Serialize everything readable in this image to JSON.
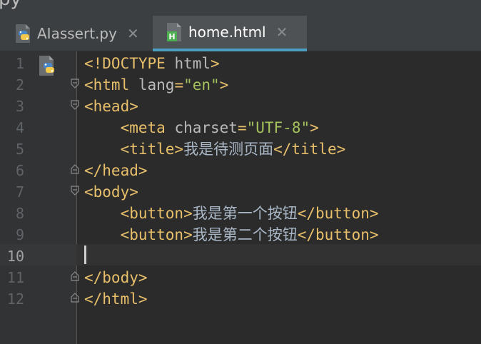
{
  "window": {
    "title_fragment": "py"
  },
  "tabs": [
    {
      "label": "AIassert.py",
      "icon": "python-file-icon",
      "active": false,
      "close": "✕"
    },
    {
      "label": "home.html",
      "icon": "html-file-icon",
      "active": true,
      "close": "✕"
    }
  ],
  "editor": {
    "current_line": 10,
    "lines": [
      {
        "n": "1",
        "pre": "",
        "tokens": [
          [
            "tag",
            "<!DOCTYPE "
          ],
          [
            "attr",
            "html"
          ],
          [
            "tag",
            ">"
          ]
        ]
      },
      {
        "n": "2",
        "pre": "",
        "tokens": [
          [
            "tag",
            "<html "
          ],
          [
            "attr",
            "lang"
          ],
          [
            "tag",
            "="
          ],
          [
            "str",
            "\"en\""
          ],
          [
            "tag",
            ">"
          ]
        ]
      },
      {
        "n": "3",
        "pre": "",
        "tokens": [
          [
            "tag",
            "<head>"
          ]
        ]
      },
      {
        "n": "4",
        "pre": "    ",
        "tokens": [
          [
            "tag",
            "<meta "
          ],
          [
            "attr",
            "charset"
          ],
          [
            "tag",
            "="
          ],
          [
            "str",
            "\"UTF-8\""
          ],
          [
            "tag",
            ">"
          ]
        ]
      },
      {
        "n": "5",
        "pre": "    ",
        "tokens": [
          [
            "tag",
            "<title>"
          ],
          [
            "txt",
            "我是待测页面"
          ],
          [
            "tag",
            "</title>"
          ]
        ]
      },
      {
        "n": "6",
        "pre": "",
        "tokens": [
          [
            "tag",
            "</head>"
          ]
        ]
      },
      {
        "n": "7",
        "pre": "",
        "tokens": [
          [
            "tag",
            "<body>"
          ]
        ]
      },
      {
        "n": "8",
        "pre": "    ",
        "tokens": [
          [
            "tag",
            "<button>"
          ],
          [
            "txt",
            "我是第一个按钮"
          ],
          [
            "tag",
            "</button>"
          ]
        ]
      },
      {
        "n": "9",
        "pre": "    ",
        "tokens": [
          [
            "tag",
            "<button>"
          ],
          [
            "txt",
            "我是第二个按钮"
          ],
          [
            "tag",
            "</button>"
          ]
        ]
      },
      {
        "n": "10",
        "pre": "",
        "tokens": []
      },
      {
        "n": "11",
        "pre": "",
        "tokens": [
          [
            "tag",
            "</body>"
          ]
        ]
      },
      {
        "n": "12",
        "pre": "",
        "tokens": [
          [
            "tag",
            "</html>"
          ]
        ]
      }
    ]
  },
  "colors": {
    "background": "#2b2b2b",
    "tag": "#e8bf6a",
    "attribute": "#bababa",
    "string": "#a5c25c",
    "text": "#a9b7c6",
    "line_number": "#606366",
    "tab_active_underline": "#4a9fc0"
  }
}
